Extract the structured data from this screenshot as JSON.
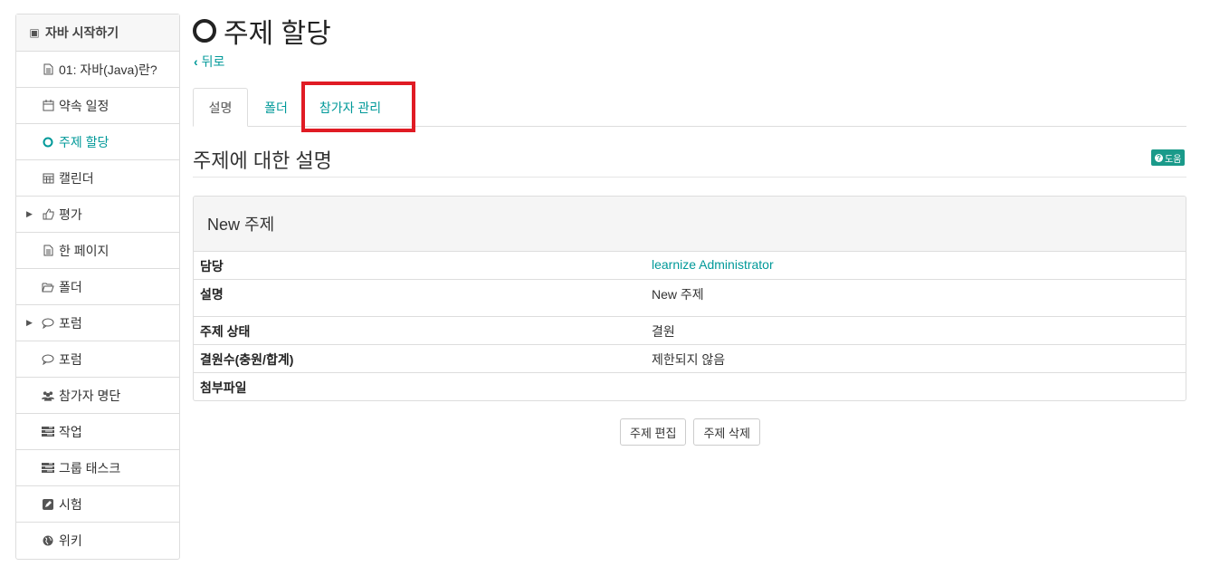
{
  "sidebar": {
    "header": "자바 시작하기",
    "items": [
      {
        "label": "01: 자바(Java)란?",
        "icon": "document-icon"
      },
      {
        "label": "약속 일정",
        "icon": "calendar-icon"
      },
      {
        "label": "주제 할당",
        "icon": "circle-icon"
      },
      {
        "label": "캘린더",
        "icon": "calendar-grid-icon"
      },
      {
        "label": "평가",
        "icon": "thumbs-up-icon"
      },
      {
        "label": "한 페이지",
        "icon": "document-icon"
      },
      {
        "label": "폴더",
        "icon": "folder-open-icon"
      },
      {
        "label": "포럼",
        "icon": "comments-icon"
      },
      {
        "label": "포럼",
        "icon": "comments-icon"
      },
      {
        "label": "참가자 명단",
        "icon": "users-icon"
      },
      {
        "label": "작업",
        "icon": "tasks-icon"
      },
      {
        "label": "그룹 태스크",
        "icon": "tasks-icon"
      },
      {
        "label": "시험",
        "icon": "edit-icon"
      },
      {
        "label": "위키",
        "icon": "globe-icon"
      }
    ]
  },
  "page": {
    "title": "주제 할당",
    "back_label": "뒤로"
  },
  "tabs": [
    "설명",
    "폴더",
    "참가자 관리"
  ],
  "section": {
    "title": "주제에 대한 설명",
    "help_label": "도움"
  },
  "panel": {
    "heading": "New 주제",
    "rows": [
      {
        "key": "담당",
        "value": "learnize Administrator"
      },
      {
        "key": "설명",
        "value": "New 주제"
      },
      {
        "key": "주제 상태",
        "value": "결원"
      },
      {
        "key": "결원수(충원/합계)",
        "value": "제한되지 않음"
      },
      {
        "key": "첨부파일",
        "value": ""
      }
    ]
  },
  "actions": {
    "edit_label": "주제 편집",
    "delete_label": "주제 삭제"
  },
  "colors": {
    "accent": "#009999",
    "highlight": "#e01b24"
  }
}
